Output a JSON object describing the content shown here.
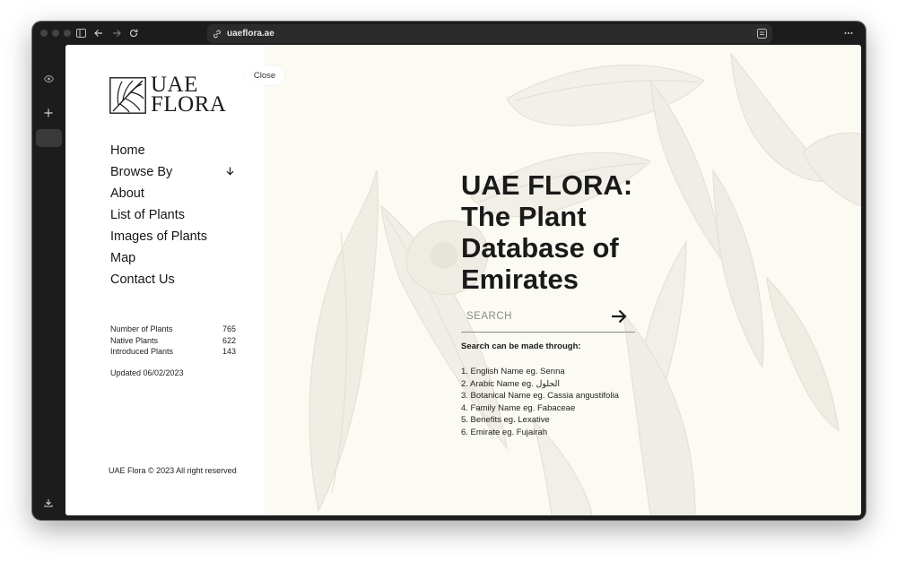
{
  "browser": {
    "url": "uaeflora.ae"
  },
  "logo": {
    "line1": "UAE",
    "line2": "FLORA"
  },
  "close_label": "Close",
  "nav": [
    {
      "label": "Home"
    },
    {
      "label": "Browse By",
      "has_dropdown": true
    },
    {
      "label": "About"
    },
    {
      "label": "List of Plants"
    },
    {
      "label": "Images of Plants"
    },
    {
      "label": "Map"
    },
    {
      "label": "Contact Us"
    }
  ],
  "stats": [
    {
      "label": "Number of Plants",
      "value": "765"
    },
    {
      "label": "Native Plants",
      "value": "622"
    },
    {
      "label": "Introduced Plants",
      "value": "143"
    }
  ],
  "updated": "Updated 06/02/2023",
  "footer": "UAE Flora © 2023 All right reserved",
  "hero": {
    "title_lines": [
      "UAE FLORA:",
      "The Plant",
      "Database of",
      "Emirates"
    ]
  },
  "search": {
    "placeholder": "SEARCH",
    "heading": "Search can be made through:",
    "options": [
      "1. English Name eg. Senna",
      "2. Arabic Name eg. الحلول",
      "3. Botanical Name eg. Cassia angustifolia",
      "4. Family Name eg. Fabaceae",
      "5. Benefits eg. Lexative",
      "6. Emirate eg. Fujairah"
    ]
  },
  "colors": {
    "page_bg": "#fbfaf3",
    "panel_bg": "#ffffff",
    "text": "#1a1a1a",
    "browser_chrome": "#1c1c1c"
  }
}
